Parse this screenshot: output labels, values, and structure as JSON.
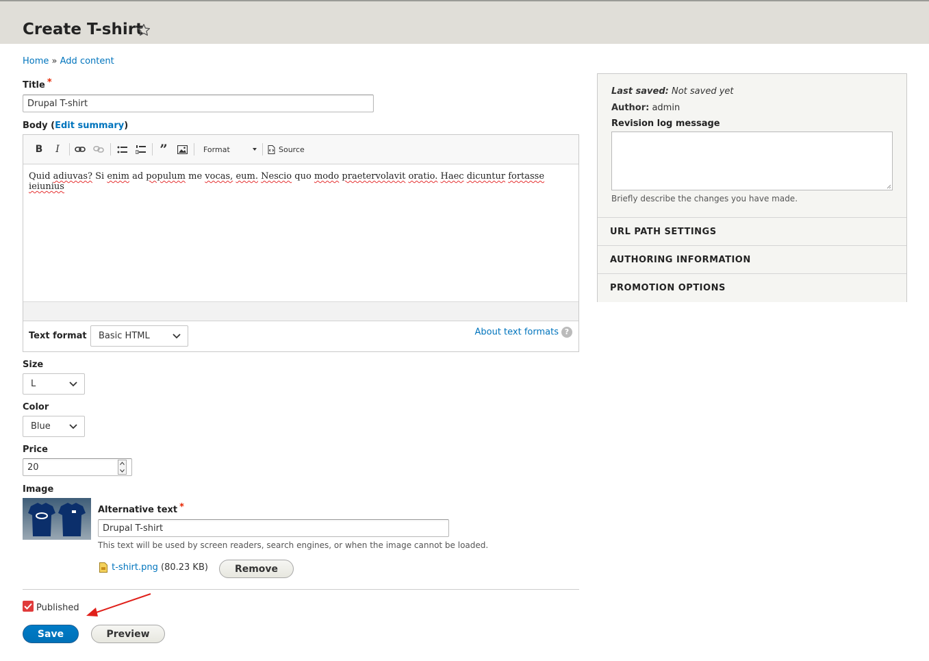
{
  "page": {
    "title": "Create T-shirt"
  },
  "breadcrumb": {
    "home": "Home",
    "separator": "»",
    "add_content": "Add content"
  },
  "title_field": {
    "label": "Title",
    "required_mark": "*",
    "value": "Drupal T-shirt"
  },
  "body_field": {
    "label": "Body (",
    "edit_summary": "Edit summary",
    "label_end": ")",
    "toolbar": {
      "bold": "B",
      "italic": "I",
      "format_label": "Format",
      "source_label": "Source"
    },
    "content_words": [
      "Quid",
      "adiuvas?",
      "Si",
      "enim",
      "ad",
      "populum",
      "me",
      "vocas,",
      "eum.",
      "Nescio",
      "quo",
      "modo",
      "praetervolavit",
      "oratio.",
      "Haec",
      "dicuntur",
      "fortasse",
      "ieiunius"
    ],
    "text_format_label": "Text format",
    "text_format_value": "Basic HTML",
    "about_text_formats": "About text formats",
    "help_glyph": "?"
  },
  "size_field": {
    "label": "Size",
    "value": "L"
  },
  "color_field": {
    "label": "Color",
    "value": "Blue"
  },
  "price_field": {
    "label": "Price",
    "value": "20"
  },
  "image_field": {
    "label": "Image",
    "alt_label": "Alternative text",
    "alt_required_mark": "*",
    "alt_value": "Drupal T-shirt",
    "alt_description": "This text will be used by screen readers, search engines, or when the image cannot be loaded.",
    "file_name": "t-shirt.png",
    "file_size": "(80.23 KB)",
    "remove_label": "Remove"
  },
  "published": {
    "label": "Published",
    "checked": true
  },
  "actions": {
    "save_label": "Save",
    "preview_label": "Preview"
  },
  "sidebar": {
    "last_saved_label": "Last saved:",
    "last_saved_value": "Not saved yet",
    "author_label": "Author:",
    "author_value": "admin",
    "revision_label": "Revision log message",
    "revision_value": "",
    "revision_description": "Briefly describe the changes you have made.",
    "sections": [
      "URL PATH SETTINGS",
      "AUTHORING INFORMATION",
      "PROMOTION OPTIONS"
    ]
  },
  "colors": {
    "link": "#0074bd",
    "primary_button": "#0071b8",
    "required": "#e62600",
    "header_bg": "#e0ded8",
    "checkbox": "#e03b3b",
    "annotation_arrow": "#e0201a"
  }
}
